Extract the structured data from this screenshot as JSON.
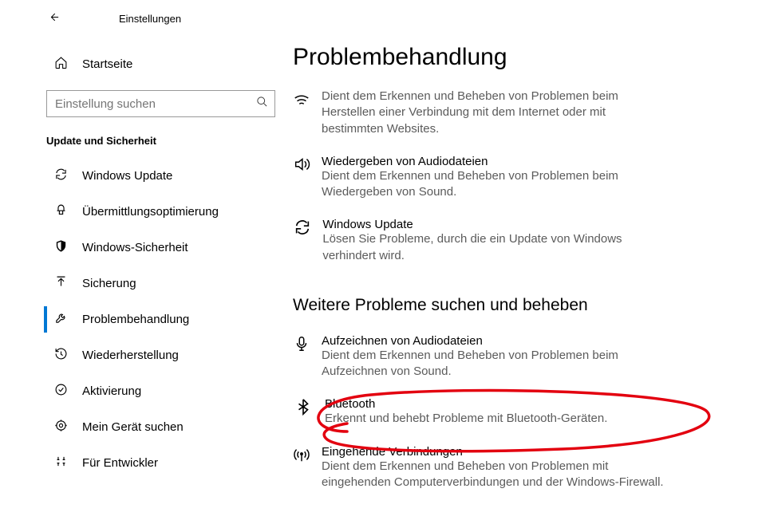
{
  "window": {
    "title": "Einstellungen"
  },
  "sidebar": {
    "home": "Startseite",
    "search_placeholder": "Einstellung suchen",
    "category": "Update und Sicherheit",
    "items": [
      {
        "label": "Windows Update"
      },
      {
        "label": "Übermittlungsoptimierung"
      },
      {
        "label": "Windows-Sicherheit"
      },
      {
        "label": "Sicherung"
      },
      {
        "label": "Problembehandlung"
      },
      {
        "label": "Wiederherstellung"
      },
      {
        "label": "Aktivierung"
      },
      {
        "label": "Mein Gerät suchen"
      },
      {
        "label": "Für Entwickler"
      }
    ]
  },
  "main": {
    "title": "Problembehandlung",
    "primary_items": [
      {
        "title": "",
        "desc": "Dient dem Erkennen und Beheben von Problemen beim Herstellen einer Verbindung mit dem Internet oder mit bestimmten Websites."
      },
      {
        "title": "Wiedergeben von Audiodateien",
        "desc": "Dient dem Erkennen und Beheben von Problemen beim Wiedergeben von Sound."
      },
      {
        "title": "Windows Update",
        "desc": "Lösen Sie Probleme, durch die ein Update von Windows verhindert wird."
      }
    ],
    "section2_title": "Weitere Probleme suchen und beheben",
    "secondary_items": [
      {
        "title": "Aufzeichnen von Audiodateien",
        "desc": "Dient dem Erkennen und Beheben von Problemen beim Aufzeichnen von Sound."
      },
      {
        "title": "Bluetooth",
        "desc": "Erkennt und behebt Probleme mit Bluetooth-Geräten."
      },
      {
        "title": "Eingehende Verbindungen",
        "desc": "Dient dem Erkennen und Beheben von Problemen mit eingehenden Computerverbindungen und der Windows-Firewall."
      }
    ]
  },
  "annotations": {
    "highlight_color": "#f0ff00",
    "circle_color": "#e3000f"
  }
}
